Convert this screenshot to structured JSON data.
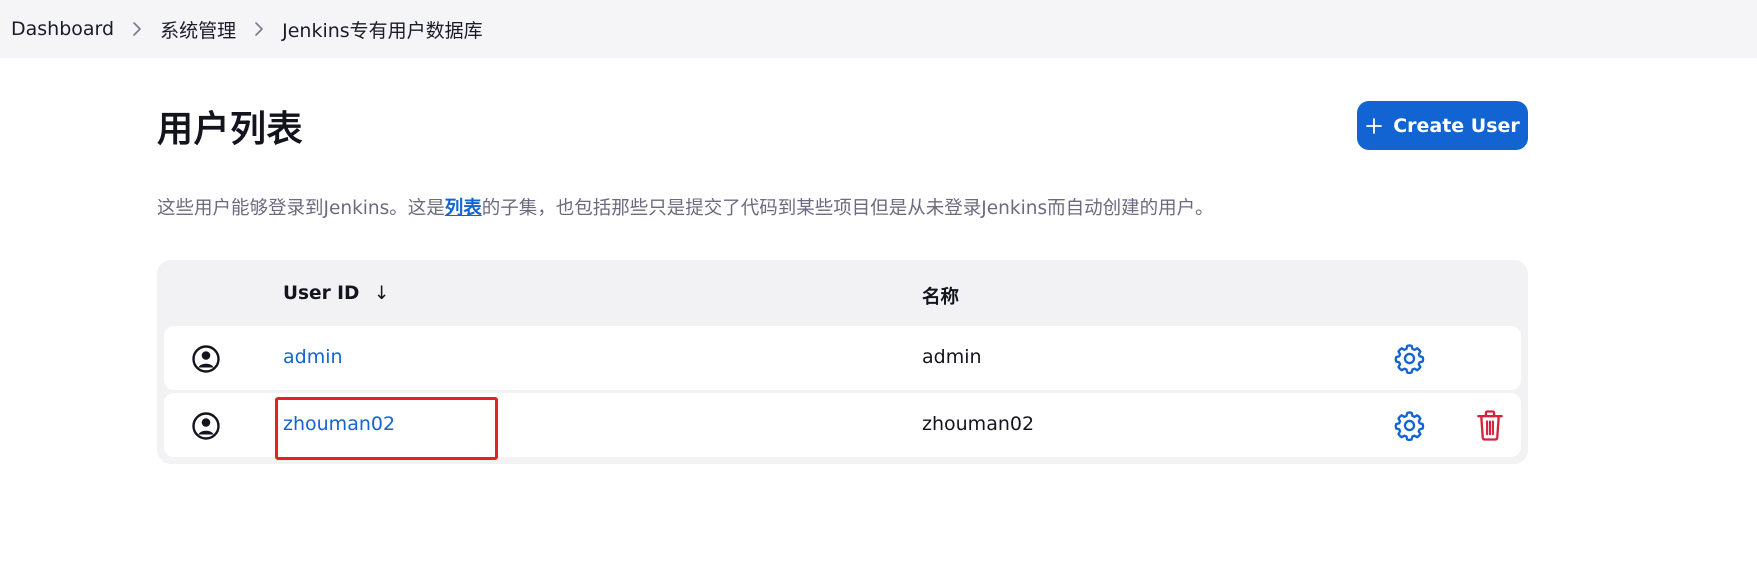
{
  "breadcrumb": [
    {
      "label": "Dashboard"
    },
    {
      "label": "系统管理"
    },
    {
      "label": "Jenkins专有用户数据库"
    }
  ],
  "page": {
    "title": "用户列表",
    "create_button_label": "Create User",
    "description_before": "这些用户能够登录到Jenkins。这是",
    "description_link": "列表",
    "description_after": "的子集，也包括那些只是提交了代码到某些项目但是从未登录Jenkins而自动创建的用户。"
  },
  "table": {
    "columns": {
      "user_id": "User ID",
      "sort_indicator": "↓",
      "name": "名称"
    },
    "rows": [
      {
        "user_id": "admin",
        "name": "admin",
        "deletable": false
      },
      {
        "user_id": "zhouman02",
        "name": "zhouman02",
        "deletable": true
      }
    ]
  },
  "icons": {
    "breadcrumb_separator": "chevron-right-icon",
    "create": "plus-icon",
    "avatar": "user-circle-icon",
    "configure": "gear-icon",
    "delete": "trash-icon"
  },
  "colors": {
    "primary": "#1364d3",
    "danger": "#d4243c",
    "annotation": "#e4231c"
  }
}
